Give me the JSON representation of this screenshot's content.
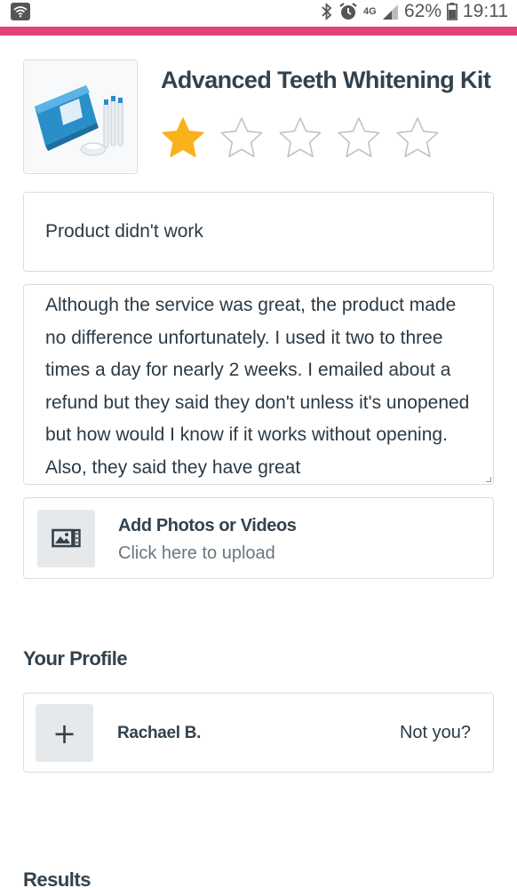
{
  "status_bar": {
    "battery": "62%",
    "time": "19:11",
    "network": "4G",
    "icons": [
      "wifi-icon",
      "bluetooth-icon",
      "alarm-icon",
      "signal-icon",
      "battery-icon"
    ]
  },
  "colors": {
    "accent": "#e3407d",
    "star_filled": "#f9b21c",
    "star_empty": "#b9c0c6",
    "border": "#d8dde2",
    "text": "#2b3a45"
  },
  "product": {
    "title": "Advanced Teeth Whitening Kit",
    "rating": 1,
    "rating_max": 5
  },
  "review": {
    "headline": "Product didn't work",
    "body": "Although the service was great, the product made no difference unfortunately. I used it two to three times a day for nearly 2 weeks.  I emailed about a refund but they said they don't unless it's unopened but how would I know if it works without opening. Also, they said they have great"
  },
  "upload": {
    "title": "Add Photos or Videos",
    "subtitle": "Click here to upload",
    "icon": "image-upload-icon"
  },
  "profile": {
    "section_title": "Your Profile",
    "name": "Rachael B.",
    "not_you": "Not you?",
    "add_icon": "plus-icon"
  },
  "results": {
    "section_title": "Results"
  }
}
